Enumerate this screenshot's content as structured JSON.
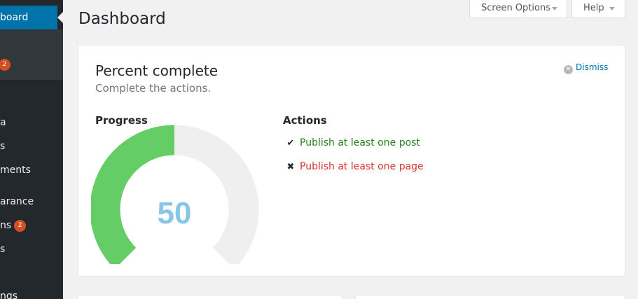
{
  "sidebar": {
    "active_label": "board",
    "items": [
      {
        "label": "",
        "badge": "2"
      },
      {
        "label": "a"
      },
      {
        "label": "s"
      },
      {
        "label": "ments"
      },
      {
        "label": "arance"
      },
      {
        "label": "ns",
        "badge": "2"
      },
      {
        "label": "s"
      },
      {
        "label": "ngs"
      }
    ]
  },
  "header": {
    "page_title": "Dashboard",
    "screen_options_label": "Screen Options",
    "help_label": "Help"
  },
  "widget": {
    "title": "Percent complete",
    "subtitle": "Complete the actions.",
    "dismiss_label": "Dismiss",
    "progress_heading": "Progress",
    "progress_value": "50",
    "progress_fraction": 0.5,
    "actions_heading": "Actions",
    "actions": [
      {
        "label": "Publish at least one post",
        "status": "done",
        "color": "#2a7f1f"
      },
      {
        "label": "Publish at least one page",
        "status": "not-done",
        "color": "#dc3232"
      }
    ]
  },
  "colors": {
    "gauge_fill": "#65cd65",
    "gauge_track": "#efefef",
    "gauge_value": "#88c6e8",
    "accent": "#0073aa",
    "badge": "#d54e21"
  }
}
